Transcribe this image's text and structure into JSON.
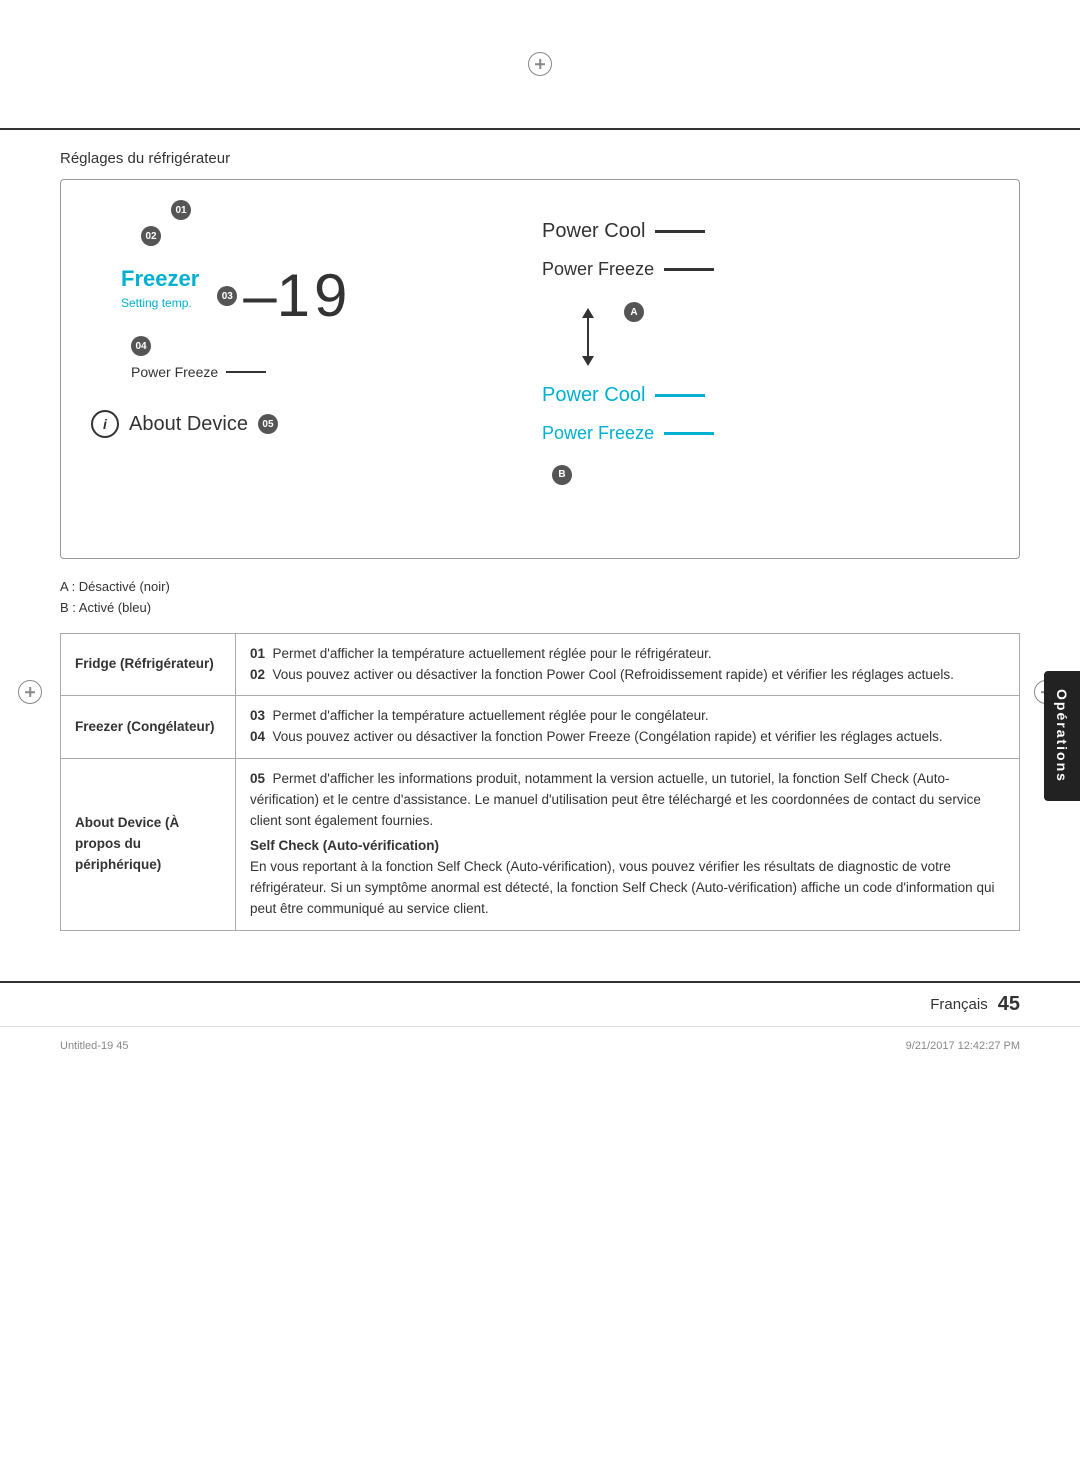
{
  "page": {
    "top_crosshair": "⊕",
    "left_crosshair": "⊕",
    "right_crosshair": "⊕",
    "language_label": "Français",
    "page_number": "45",
    "right_tab_label": "Opérations",
    "footer_file": "Untitled-19    45",
    "footer_date": "9/21/2017    12:42:27 PM"
  },
  "section": {
    "title": "Réglages du réfrigérateur"
  },
  "diagram": {
    "badge_01": "01",
    "badge_02": "02",
    "badge_03": "03",
    "badge_04": "04",
    "badge_05": "05",
    "badge_A": "A",
    "badge_B": "B",
    "freezer_label": "Freezer",
    "freezer_temp": "-1",
    "freezer_temp_c": "9",
    "freezer_setting": "Setting temp.",
    "power_freeze_left": "Power Freeze",
    "power_cool_right_black": "Power Cool",
    "power_freeze_right_black": "Power Freeze",
    "power_cool_right_blue": "Power Cool",
    "power_freeze_right_blue": "Power Freeze",
    "about_device": "About Device"
  },
  "legend": {
    "A_label": "A : Désactivé (noir)",
    "B_label": "B : Activé (bleu)"
  },
  "table": {
    "rows": [
      {
        "label": "Fridge (Réfrigérateur)",
        "items": [
          {
            "num": "01",
            "text": "Permet d'afficher la température actuellement réglée pour le réfrigérateur."
          },
          {
            "num": "02",
            "text": "Vous pouvez activer ou désactiver la fonction Power Cool (Refroidissement rapide) et vérifier les réglages actuels."
          }
        ]
      },
      {
        "label": "Freezer (Congélateur)",
        "items": [
          {
            "num": "03",
            "text": "Permet d'afficher la température actuellement réglée pour le congélateur."
          },
          {
            "num": "04",
            "text": "Vous pouvez activer ou désactiver la fonction Power Freeze (Congélation rapide) et vérifier les réglages actuels."
          }
        ]
      },
      {
        "label": "About Device (À propos du périphérique)",
        "items": [
          {
            "num": "05",
            "text": "Permet d'afficher les informations produit, notamment la version actuelle, un tutoriel, la fonction Self Check (Auto-vérification) et le centre d'assistance. Le manuel d'utilisation peut être téléchargé et les coordonnées de contact du service client sont également fournies."
          }
        ],
        "self_check_title": "Self Check (Auto-vérification)",
        "self_check_text": "En vous reportant à la fonction Self Check (Auto-vérification), vous pouvez vérifier les résultats de diagnostic de votre réfrigérateur. Si un symptôme anormal est détecté, la fonction Self Check (Auto-vérification) affiche un code d'information qui peut être communiqué au service client."
      }
    ]
  }
}
